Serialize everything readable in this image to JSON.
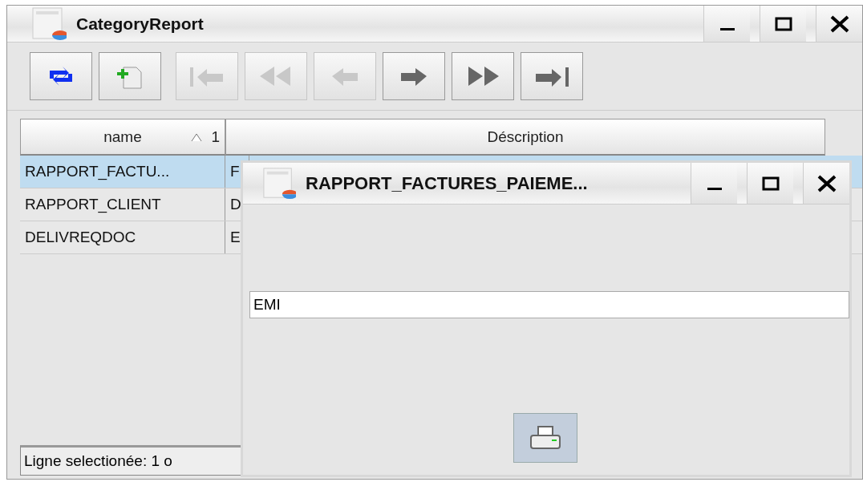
{
  "window": {
    "title": "CategoryReport"
  },
  "toolbar": [
    {
      "kind": "refresh",
      "disabled": false
    },
    {
      "kind": "add",
      "disabled": false
    },
    {
      "kind": "first",
      "disabled": true
    },
    {
      "kind": "rewind",
      "disabled": true
    },
    {
      "kind": "previous",
      "disabled": true
    },
    {
      "kind": "next",
      "disabled": false
    },
    {
      "kind": "forward",
      "disabled": false
    },
    {
      "kind": "last",
      "disabled": false
    }
  ],
  "table": {
    "columns": [
      {
        "label": "name",
        "sort_mark": "1"
      },
      {
        "label": "Déscription"
      }
    ],
    "rows": [
      {
        "cells": [
          "RAPPORT_FACTU...",
          "F"
        ],
        "selected": true
      },
      {
        "cells": [
          "RAPPORT_CLIENT",
          "D"
        ],
        "selected": false
      },
      {
        "cells": [
          "DELIVREQDOC",
          "E"
        ],
        "selected": false
      }
    ]
  },
  "status_bar": "Ligne selectionée: 1 o",
  "dialog": {
    "title": "RAPPORT_FACTURES_PAIEME...",
    "field_value": "EMI"
  }
}
